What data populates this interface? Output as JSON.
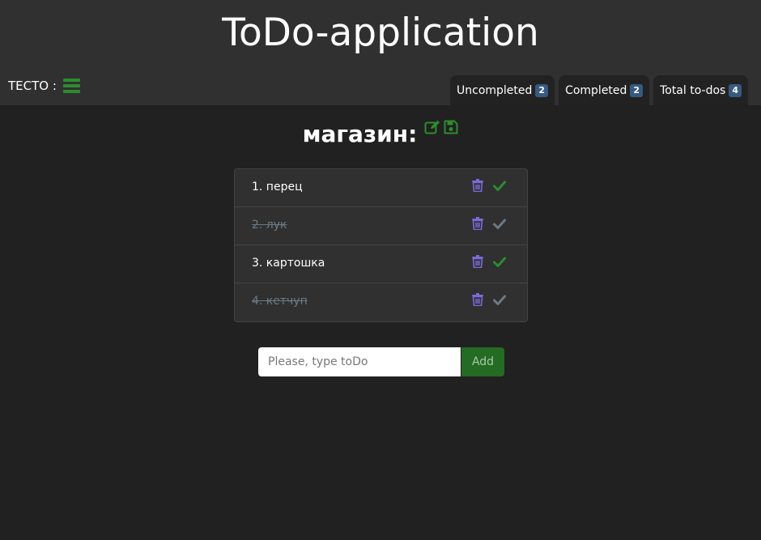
{
  "app": {
    "title": "ToDo-application",
    "user_name": "TECTO :"
  },
  "tabs": [
    {
      "label": "Uncompleted",
      "count": "2"
    },
    {
      "label": "Completed",
      "count": "2"
    },
    {
      "label": "Total to-dos",
      "count": "4"
    }
  ],
  "list": {
    "title": "магазин:",
    "items": [
      {
        "text": "1. перец",
        "completed": false
      },
      {
        "text": "2. лук",
        "completed": true
      },
      {
        "text": "3. картошка",
        "completed": false
      },
      {
        "text": "4. кетчуп",
        "completed": true
      }
    ]
  },
  "form": {
    "placeholder": "Please, type toDo",
    "value": "",
    "add_label": "Add"
  },
  "colors": {
    "accent_green": "#2e8b2e",
    "delete_purple": "#7a6bd8",
    "check_done_gray": "#6b7a85",
    "badge_blue": "#375a7f",
    "background": "#212121",
    "header": "#303030"
  },
  "icons": {
    "menu": "hamburger-menu-icon",
    "edit": "edit-icon",
    "save": "save-icon",
    "delete": "trash-icon",
    "complete": "check-icon"
  }
}
